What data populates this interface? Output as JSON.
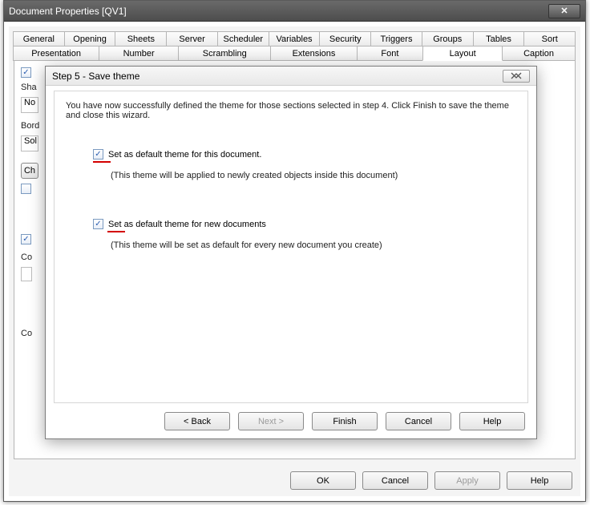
{
  "window": {
    "title": "Document Properties [QV1]",
    "tabs_row1": [
      "General",
      "Opening",
      "Sheets",
      "Server",
      "Scheduler",
      "Variables",
      "Security",
      "Triggers",
      "Groups",
      "Tables",
      "Sort"
    ],
    "tabs_row2": [
      "Presentation",
      "Number",
      "Scrambling",
      "Extensions",
      "Font",
      "Layout",
      "Caption"
    ],
    "active_tab": "Layout",
    "bg": {
      "shadow_label": "Sha",
      "shadow_value": "No",
      "border_label": "Bord",
      "border_value": "Sol",
      "ch_label": "Ch",
      "co_label": "Co",
      "co2_label": "Co"
    },
    "buttons": {
      "ok": "OK",
      "cancel": "Cancel",
      "apply": "Apply",
      "help": "Help"
    }
  },
  "wizard": {
    "title": "Step 5 - Save theme",
    "intro": "You have now successfully defined the theme for those sections selected in step 4. Click Finish to save the theme and close this wizard.",
    "opt1_label": "Set as default theme for this document.",
    "opt1_hint": "(This theme will be applied to newly created objects inside this document)",
    "opt2_label": "Set as default theme for new documents",
    "opt2_hint": "(This theme will be set as default for every new document you create)",
    "buttons": {
      "back": "< Back",
      "next": "Next >",
      "finish": "Finish",
      "cancel": "Cancel",
      "help": "Help"
    }
  }
}
